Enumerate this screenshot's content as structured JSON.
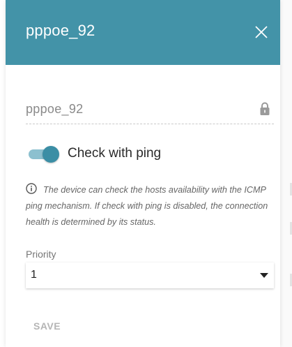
{
  "dialog": {
    "title": "pppoe_92",
    "close_icon": "close-icon"
  },
  "name_field": {
    "value": "pppoe_92",
    "locked": true,
    "lock_icon": "lock-icon"
  },
  "ping_toggle": {
    "label": "Check with ping",
    "checked": true
  },
  "info": {
    "icon": "info-icon",
    "text": "The device can check the hosts availability with the ICMP ping mechanism. If check with ping is disabled, the connection health is determined by its status."
  },
  "priority": {
    "label": "Priority",
    "selected": "1"
  },
  "actions": {
    "save_label": "SAVE",
    "save_enabled": false
  },
  "colors": {
    "header": "#4393a8",
    "toggle_knob": "#3b8ea5",
    "toggle_track": "#8cc0cf"
  }
}
